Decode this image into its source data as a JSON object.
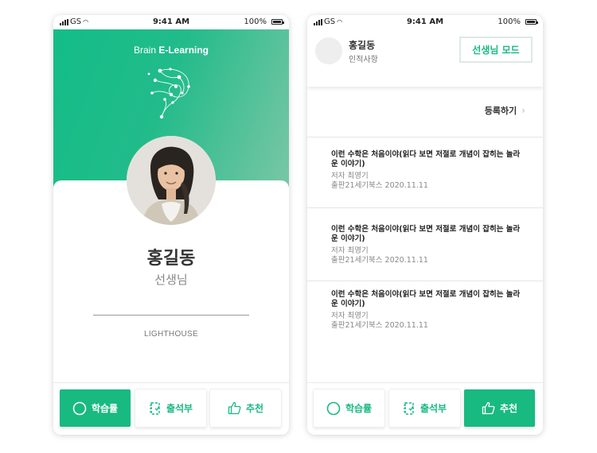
{
  "status_bar": {
    "carrier": "GS",
    "time": "9:41 AM",
    "battery": "100%"
  },
  "screen1": {
    "brand_prefix": "Brain",
    "brand_main": "E-Learning",
    "profile": {
      "name": "홍길동",
      "role": "선생님",
      "organization": "LIGHTHOUSE"
    }
  },
  "screen2": {
    "header": {
      "name": "홍길동",
      "subtitle": "인적사항",
      "mode_button": "선생님 모드"
    },
    "register_label": "등록하기",
    "books": [
      {
        "title_line1": "이런 수학은 처음이야(읽다 보면 저절로 개념이 잡히는 놀라",
        "title_line2": "운 이야기)",
        "author": "저자 최영기",
        "publisher": "출판21세기북스 2020.11.11"
      },
      {
        "title_line1": "이런 수학은 처음이야(읽다 보면 저절로 개념이 잡히는 놀라",
        "title_line2": "운 이야기)",
        "author": "저자 최영기",
        "publisher": "출판21세기북스 2020.11.11"
      },
      {
        "title_line1": "이런 수학은 처음이야(읽다 보면 저절로 개념이 잡히는 놀라",
        "title_line2": "운 이야기)",
        "author": "저자 최영기",
        "publisher": "출판21세기북스 2020.11.11"
      }
    ]
  },
  "tabs": [
    {
      "label": "학습률",
      "icon": "circle-icon"
    },
    {
      "label": "출석부",
      "icon": "notebook-icon"
    },
    {
      "label": "추천",
      "icon": "thumbs-up-icon"
    }
  ],
  "colors": {
    "accent": "#19b982",
    "hero_start": "#13bd86",
    "hero_end": "#7cc7a6"
  }
}
